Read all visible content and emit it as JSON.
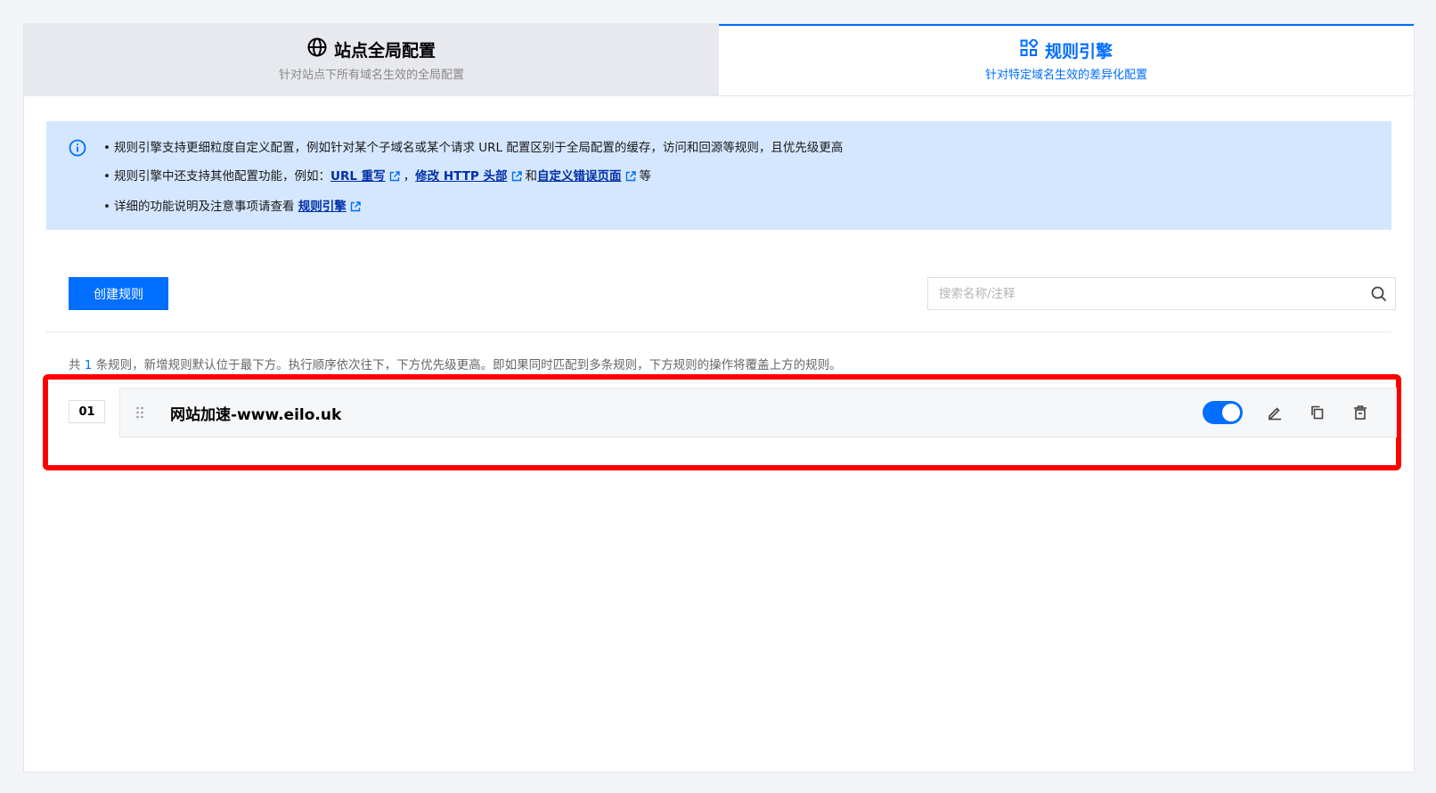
{
  "tabs": [
    {
      "title": "站点全局配置",
      "subtitle": "针对站点下所有域名生效的全局配置",
      "icon": "globe-icon",
      "active": false
    },
    {
      "title": "规则引擎",
      "subtitle": "针对特定域名生效的差异化配置",
      "icon": "grid-icon",
      "active": true
    }
  ],
  "notice": {
    "line1": "规则引擎支持更细粒度自定义配置，例如针对某个子域名或某个请求 URL 配置区别于全局配置的缓存，访问和回源等规则，且优先级更高",
    "line2_prefix": "规则引擎中还支持其他配置功能，例如：",
    "link_url_rewrite": "URL 重写",
    "sep_comma": "，",
    "link_http_header": "修改 HTTP 头部",
    "sep_and": "和",
    "link_error_page": "自定义错误页面",
    "line2_suffix": "等",
    "line3_prefix": "详细的功能说明及注意事项请查看",
    "link_rule_engine": "规则引擎"
  },
  "toolbar": {
    "create_label": "创建规则",
    "search_placeholder": "搜索名称/注释"
  },
  "summary": {
    "prefix": "共",
    "count": "1",
    "suffix": "条规则，新增规则默认位于最下方。执行顺序依次往下，下方优先级更高。即如果同时匹配到多条规则，下方规则的操作将覆盖上方的规则。"
  },
  "rules": [
    {
      "index": "01",
      "name": "网站加速-www.eilo.uk",
      "enabled": true
    }
  ],
  "colors": {
    "accent": "#006eff",
    "notice_bg": "#d5e7ff",
    "highlight": "#ff0000"
  }
}
